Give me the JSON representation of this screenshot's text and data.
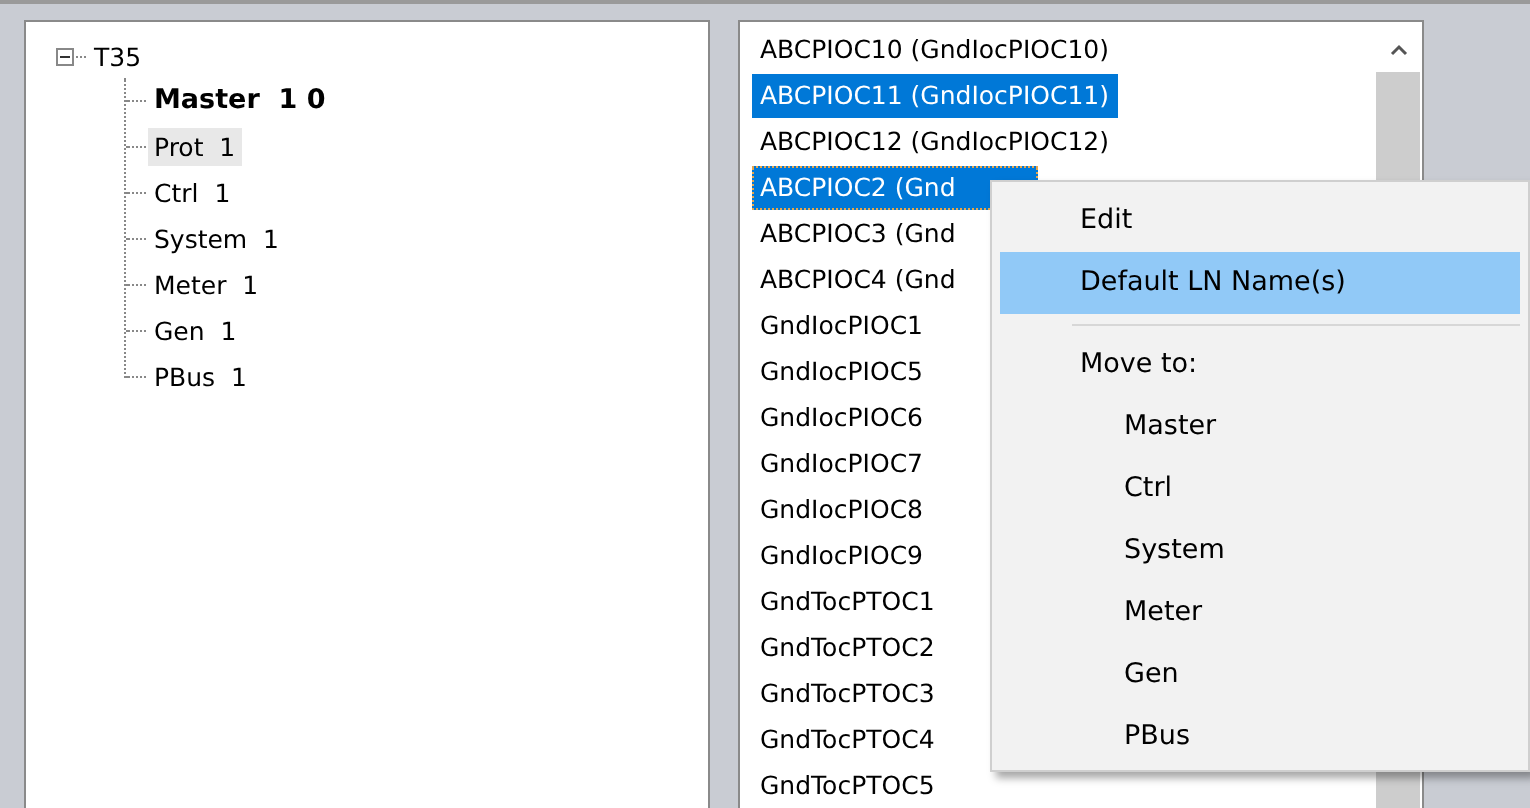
{
  "tree": {
    "label": "T35",
    "expanded": true,
    "children": [
      {
        "label": "Master  1 0",
        "bold": true,
        "selected": false
      },
      {
        "label": "Prot  1",
        "bold": false,
        "selected": true
      },
      {
        "label": "Ctrl  1",
        "bold": false,
        "selected": false
      },
      {
        "label": "System  1",
        "bold": false,
        "selected": false
      },
      {
        "label": "Meter  1",
        "bold": false,
        "selected": false
      },
      {
        "label": "Gen  1",
        "bold": false,
        "selected": false
      },
      {
        "label": "PBus  1",
        "bold": false,
        "selected": false
      }
    ]
  },
  "list": {
    "items": [
      {
        "label": "ABCPIOC10 (GndIocPIOC10)",
        "selected": false,
        "focused": false
      },
      {
        "label": "ABCPIOC11 (GndIocPIOC11)",
        "selected": true,
        "focused": false
      },
      {
        "label": "ABCPIOC12 (GndIocPIOC12)",
        "selected": false,
        "focused": false
      },
      {
        "label": "ABCPIOC2 (Gnd",
        "selected": true,
        "focused": true
      },
      {
        "label": "ABCPIOC3 (Gnd",
        "selected": false,
        "focused": false
      },
      {
        "label": "ABCPIOC4 (Gnd",
        "selected": false,
        "focused": false
      },
      {
        "label": "GndIocPIOC1",
        "selected": false,
        "focused": false
      },
      {
        "label": "GndIocPIOC5",
        "selected": false,
        "focused": false
      },
      {
        "label": "GndIocPIOC6",
        "selected": false,
        "focused": false
      },
      {
        "label": "GndIocPIOC7",
        "selected": false,
        "focused": false
      },
      {
        "label": "GndIocPIOC8",
        "selected": false,
        "focused": false
      },
      {
        "label": "GndIocPIOC9",
        "selected": false,
        "focused": false
      },
      {
        "label": "GndTocPTOC1",
        "selected": false,
        "focused": false
      },
      {
        "label": "GndTocPTOC2",
        "selected": false,
        "focused": false
      },
      {
        "label": "GndTocPTOC3",
        "selected": false,
        "focused": false
      },
      {
        "label": "GndTocPTOC4",
        "selected": false,
        "focused": false
      },
      {
        "label": "GndTocPTOC5",
        "selected": false,
        "focused": false
      }
    ]
  },
  "context_menu": {
    "items": [
      {
        "kind": "item",
        "label": "Edit",
        "selected": false
      },
      {
        "kind": "item",
        "label": "Default LN Name(s)",
        "selected": true
      },
      {
        "kind": "separator"
      },
      {
        "kind": "header",
        "label": "Move to:"
      },
      {
        "kind": "subitem",
        "label": "Master",
        "selected": false
      },
      {
        "kind": "subitem",
        "label": "Ctrl",
        "selected": false
      },
      {
        "kind": "subitem",
        "label": "System",
        "selected": false
      },
      {
        "kind": "subitem",
        "label": "Meter",
        "selected": false
      },
      {
        "kind": "subitem",
        "label": "Gen",
        "selected": false
      },
      {
        "kind": "subitem",
        "label": "PBus",
        "selected": false
      }
    ]
  }
}
